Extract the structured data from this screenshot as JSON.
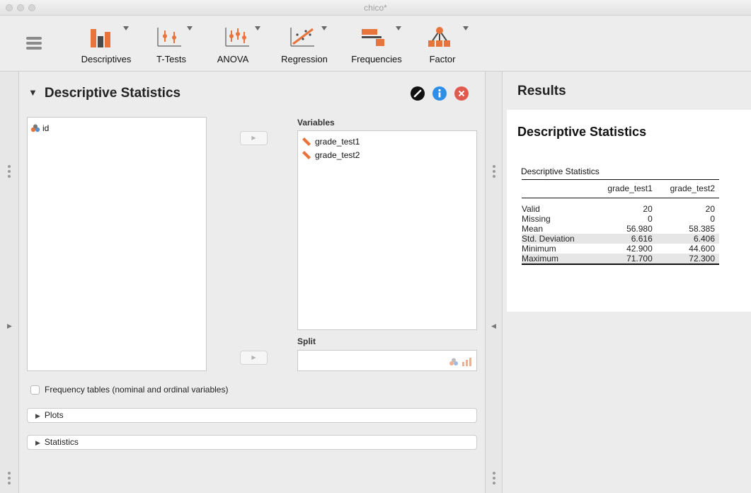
{
  "window": {
    "title": "chico*"
  },
  "toolbar": {
    "items": [
      {
        "label": "Descriptives"
      },
      {
        "label": "T-Tests"
      },
      {
        "label": "ANOVA"
      },
      {
        "label": "Regression"
      },
      {
        "label": "Frequencies"
      },
      {
        "label": "Factor"
      }
    ]
  },
  "analysis": {
    "title": "Descriptive Statistics",
    "source_variables": [
      "id"
    ],
    "variables_label": "Variables",
    "variables": [
      "grade_test1",
      "grade_test2"
    ],
    "split_label": "Split",
    "frequency_tables_label": "Frequency tables (nominal and ordinal variables)",
    "frequency_tables_checked": false,
    "sections": [
      {
        "label": "Plots"
      },
      {
        "label": "Statistics"
      }
    ]
  },
  "results": {
    "header": "Results",
    "title": "Descriptive Statistics",
    "table_caption": "Descriptive Statistics",
    "columns": [
      "",
      "grade_test1",
      "grade_test2"
    ],
    "rows": [
      [
        "Valid",
        "20",
        "20"
      ],
      [
        "Missing",
        "0",
        "0"
      ],
      [
        "Mean",
        "56.980",
        "58.385"
      ],
      [
        "Std. Deviation",
        "6.616",
        "6.406"
      ],
      [
        "Minimum",
        "42.900",
        "44.600"
      ],
      [
        "Maximum",
        "71.700",
        "72.300"
      ]
    ]
  },
  "colors": {
    "accent_blue": "#2e8fe6",
    "close_red": "#e05a4f",
    "icon_orange": "#e8743b",
    "icon_dark": "#4a4a4a"
  }
}
